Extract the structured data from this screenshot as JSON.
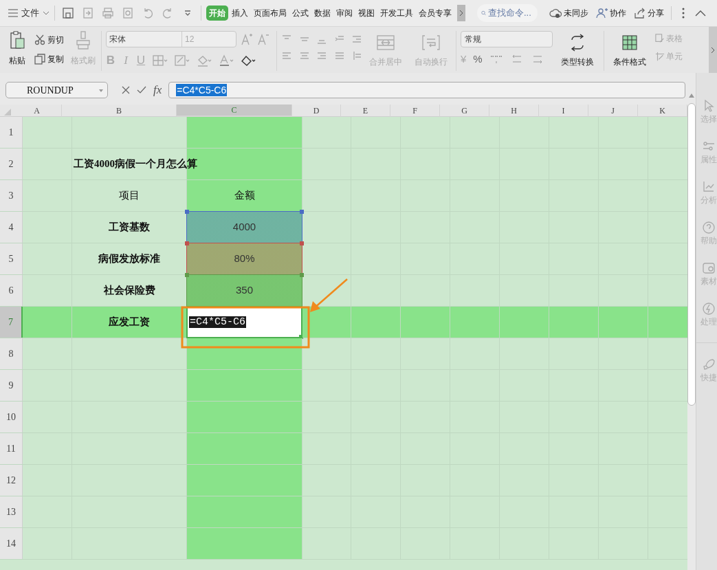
{
  "menu_bar": {
    "menu_label": "文件",
    "tabs": [
      {
        "label": "开始",
        "selected": true
      },
      {
        "label": "插入",
        "selected": false
      },
      {
        "label": "页面布局",
        "selected": false
      },
      {
        "label": "公式",
        "selected": false
      },
      {
        "label": "数据",
        "selected": false
      },
      {
        "label": "审阅",
        "selected": false
      },
      {
        "label": "视图",
        "selected": false
      },
      {
        "label": "开发工具",
        "selected": false
      },
      {
        "label": "会员专享",
        "selected": false
      }
    ],
    "search": {
      "placeholder": "查找命令..."
    },
    "actions": [
      {
        "kind": "cloud",
        "label": "未同步"
      },
      {
        "kind": "person",
        "label": "协作"
      },
      {
        "kind": "share",
        "label": "分享"
      }
    ]
  },
  "ribbon": {
    "paste": "粘贴",
    "cut": "剪切",
    "copy": "复制",
    "format_painter": "格式刷",
    "font": "宋体",
    "font_size": "12",
    "bold": "B",
    "italic": "I",
    "underline": "U",
    "merge": "合并居中",
    "wrap": "自动换行",
    "number_format": "常规",
    "currency": "¥",
    "percent": "%",
    "type_convert": "类型转换",
    "conditional_format": "条件格式",
    "table_style": "表格",
    "cell": "单元"
  },
  "formula_bar": {
    "name_box": "ROUNDUP",
    "fx": "fx",
    "formula": "=C4*C5-C6"
  },
  "sheet": {
    "columns": [
      {
        "label": "A",
        "selected": false
      },
      {
        "label": "B",
        "selected": false
      },
      {
        "label": "C",
        "selected": true
      },
      {
        "label": "D",
        "selected": false
      },
      {
        "label": "E",
        "selected": false
      },
      {
        "label": "F",
        "selected": false
      },
      {
        "label": "G",
        "selected": false
      },
      {
        "label": "H",
        "selected": false
      },
      {
        "label": "I",
        "selected": false
      },
      {
        "label": "J",
        "selected": false
      },
      {
        "label": "K",
        "selected": false
      }
    ],
    "rows": [
      {
        "number": "1",
        "selected": false,
        "kind": "empty"
      },
      {
        "number": "2",
        "selected": false,
        "kind": "title",
        "title": "工资4000病假一个月怎么算"
      },
      {
        "number": "3",
        "selected": false,
        "kind": "header",
        "item": "项目",
        "amount": "金额"
      },
      {
        "number": "4",
        "selected": false,
        "kind": "data",
        "item": "工资基数",
        "amount": "4000",
        "color": "#4a6cc4"
      },
      {
        "number": "5",
        "selected": false,
        "kind": "data",
        "item": "病假发放标准",
        "amount": "80%",
        "color": "#c0504d"
      },
      {
        "number": "6",
        "selected": false,
        "kind": "data",
        "item": "社会保险费",
        "amount": "350",
        "color": "#5f9a4a"
      },
      {
        "number": "7",
        "selected": true,
        "kind": "editing",
        "item": "应发工资",
        "formula": "=C4*C5-C6"
      },
      {
        "number": "8",
        "selected": false,
        "kind": "empty"
      },
      {
        "number": "9",
        "selected": false,
        "kind": "empty"
      },
      {
        "number": "10",
        "selected": false,
        "kind": "empty"
      },
      {
        "number": "11",
        "selected": false,
        "kind": "empty"
      },
      {
        "number": "12",
        "selected": false,
        "kind": "empty"
      },
      {
        "number": "13",
        "selected": false,
        "kind": "empty"
      },
      {
        "number": "14",
        "selected": false,
        "kind": "empty"
      }
    ]
  },
  "side_panel": [
    {
      "kind": "cursor",
      "label": "选择"
    },
    {
      "kind": "sliders",
      "label": "属性"
    },
    {
      "kind": "analyze",
      "label": "分析"
    },
    {
      "kind": "help",
      "label": "帮助"
    },
    {
      "kind": "image",
      "label": "素材"
    },
    {
      "kind": "bolt",
      "label": "处理"
    },
    {
      "kind": "rocket",
      "label": "快捷"
    }
  ]
}
